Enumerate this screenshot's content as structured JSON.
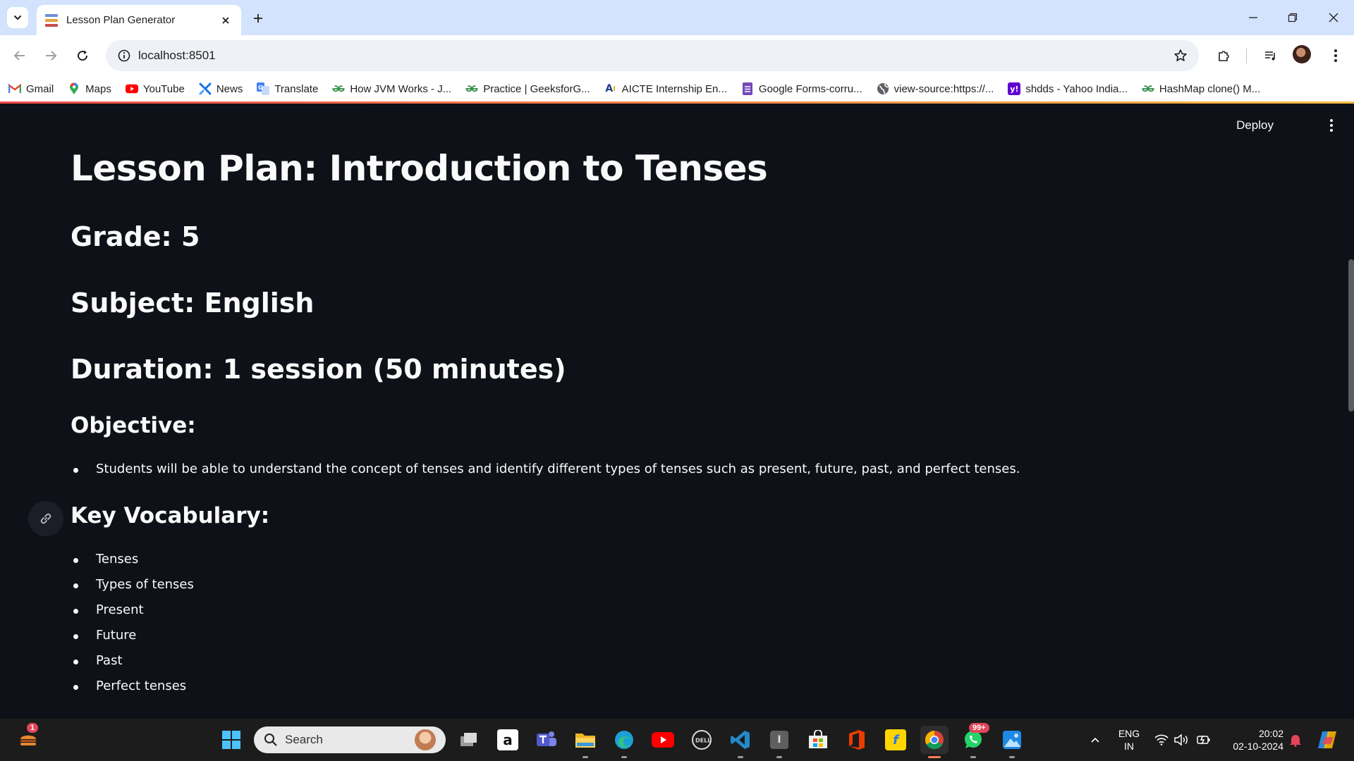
{
  "browser": {
    "tab_title": "Lesson Plan Generator",
    "url": "localhost:8501",
    "bookmarks": [
      {
        "label": "Gmail",
        "icon": "gmail-icon"
      },
      {
        "label": "Maps",
        "icon": "maps-icon"
      },
      {
        "label": "YouTube",
        "icon": "youtube-icon"
      },
      {
        "label": "News",
        "icon": "news-icon"
      },
      {
        "label": "Translate",
        "icon": "translate-icon"
      },
      {
        "label": "How JVM Works - J...",
        "icon": "geeksforgeeks-icon"
      },
      {
        "label": "Practice | GeeksforG...",
        "icon": "geeksforgeeks-icon"
      },
      {
        "label": "AICTE Internship En...",
        "icon": "aicte-icon"
      },
      {
        "label": "Google Forms-corru...",
        "icon": "google-forms-icon"
      },
      {
        "label": "view-source:https://...",
        "icon": "globe-icon"
      },
      {
        "label": "shdds - Yahoo India...",
        "icon": "yahoo-icon"
      },
      {
        "label": "HashMap clone() M...",
        "icon": "geeksforgeeks-icon"
      }
    ]
  },
  "app": {
    "deploy_label": "Deploy",
    "title": "Lesson Plan: Introduction to Tenses",
    "grade": "Grade: 5",
    "subject": "Subject: English",
    "duration": "Duration: 1 session (50 minutes)",
    "objective_heading": "Objective:",
    "objective_items": [
      "Students will be able to understand the concept of tenses and identify different types of tenses such as present, future, past, and perfect tenses."
    ],
    "vocab_heading": "Key Vocabulary:",
    "vocab_items": [
      "Tenses",
      "Types of tenses",
      "Present",
      "Future",
      "Past",
      "Perfect tenses"
    ]
  },
  "taskbar": {
    "search_placeholder": "Search",
    "widgets_badge": "1",
    "whatsapp_badge": "99+",
    "language_line1": "ENG",
    "language_line2": "IN",
    "time": "20:02",
    "date": "02-10-2024"
  },
  "colors": {
    "page_background": "#0e1117",
    "text": "#fafafa",
    "accent_gradient_start": "#ff4b4b",
    "accent_gradient_end": "#ffbd45"
  }
}
